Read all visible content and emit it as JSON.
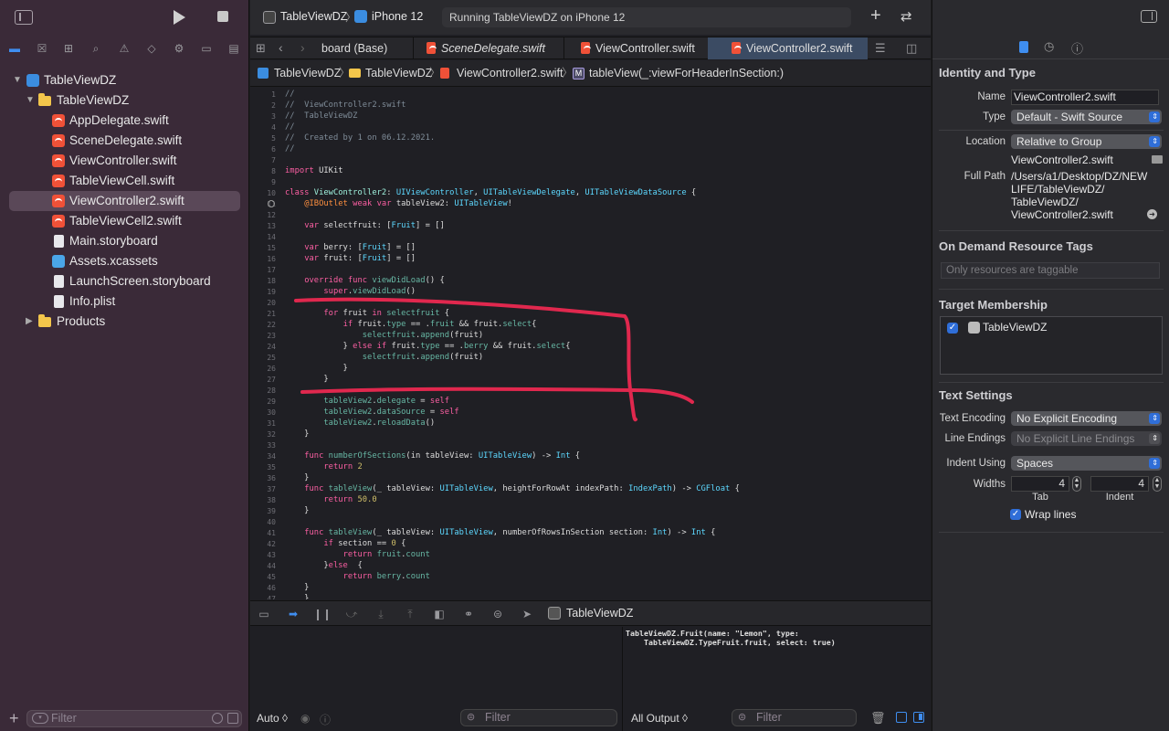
{
  "toolbar": {
    "scheme": "TableViewDZ",
    "device": "iPhone 12",
    "status": "Running TableViewDZ on iPhone 12"
  },
  "tabs": [
    {
      "label": "board (Base)"
    },
    {
      "label": "SceneDelegate.swift"
    },
    {
      "label": "ViewController.swift"
    },
    {
      "label": "ViewController2.swift"
    }
  ],
  "jumpbar": [
    "TableViewDZ",
    "TableViewDZ",
    "ViewController2.swift",
    "tableView(_:viewForHeaderInSection:)"
  ],
  "navigator": {
    "project": "TableViewDZ",
    "group": "TableViewDZ",
    "files": [
      "AppDelegate.swift",
      "SceneDelegate.swift",
      "ViewController.swift",
      "TableViewCell.swift",
      "ViewController2.swift",
      "TableViewCell2.swift",
      "Main.storyboard",
      "Assets.xcassets",
      "LaunchScreen.storyboard",
      "Info.plist"
    ],
    "products": "Products",
    "filter_placeholder": "Filter"
  },
  "code": {
    "line_numbers": [
      "1",
      "2",
      "3",
      "4",
      "5",
      "6",
      "7",
      "8",
      "9",
      "10",
      "11",
      "12",
      "13",
      "14",
      "15",
      "16",
      "17",
      "18",
      "19",
      "20",
      "21",
      "22",
      "23",
      "24",
      "25",
      "26",
      "27",
      "28",
      "29",
      "30",
      "31",
      "32",
      "33",
      "34",
      "35",
      "36",
      "37",
      "38",
      "39",
      "40",
      "41",
      "42",
      "43",
      "44",
      "45",
      "46",
      "47"
    ]
  },
  "debug": {
    "target": "TableViewDZ",
    "auto": "Auto ◊",
    "all_output": "All Output ◊",
    "filter": "Filter",
    "console_line1": "TableViewDZ.Fruit(name: \"Lemon\", type:",
    "console_line2": "    TableViewDZ.TypeFruit.fruit, select: true)"
  },
  "inspector": {
    "identity_title": "Identity and Type",
    "name_label": "Name",
    "name_value": "ViewController2.swift",
    "type_label": "Type",
    "type_value": "Default - Swift Source",
    "location_label": "Location",
    "location_value": "Relative to Group",
    "location_file": "ViewController2.swift",
    "fullpath_label": "Full Path",
    "fullpath_1": "/Users/a1/Desktop/DZ/NEW",
    "fullpath_2": "LIFE/TableViewDZ/",
    "fullpath_3": "TableViewDZ/",
    "fullpath_4": "ViewController2.swift",
    "odr_title": "On Demand Resource Tags",
    "odr_placeholder": "Only resources are taggable",
    "target_title": "Target Membership",
    "target_name": "TableViewDZ",
    "text_title": "Text Settings",
    "encoding_label": "Text Encoding",
    "encoding_value": "No Explicit Encoding",
    "endings_label": "Line Endings",
    "endings_value": "No Explicit Line Endings",
    "indent_label": "Indent Using",
    "indent_value": "Spaces",
    "widths_label": "Widths",
    "tab_width": "4",
    "indent_width": "4",
    "tab_caption": "Tab",
    "indent_caption": "Indent",
    "wrap_label": "Wrap lines"
  },
  "colors": {
    "accent": "#2f6ed8",
    "annotation": "#e0284e",
    "sidebar": "#3a2a38"
  }
}
